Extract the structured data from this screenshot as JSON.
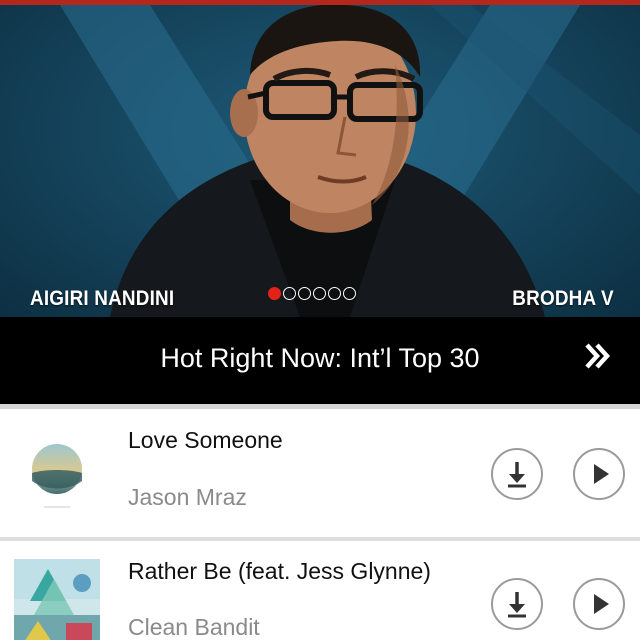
{
  "hero": {
    "caption_left": "AIGIRI NANDINI",
    "caption_right": "BRODHA V",
    "carousel_total": 6,
    "carousel_active": 1
  },
  "banner": {
    "title": "Hot Right Now: Int’l Top 30",
    "icon": "double-chevron-right-icon"
  },
  "tracks": [
    {
      "title": "Love Someone",
      "artist": "Jason Mraz",
      "download_icon": "download-icon",
      "play_icon": "play-icon"
    },
    {
      "title": "Rather Be (feat. Jess Glynne)",
      "artist": "Clean Bandit",
      "download_icon": "download-icon",
      "play_icon": "play-icon"
    }
  ],
  "colors": {
    "accent_red": "#e2231a",
    "top_bar": "#b3271c",
    "banner_bg": "#000000",
    "artist_gray": "#8a8a8a"
  }
}
